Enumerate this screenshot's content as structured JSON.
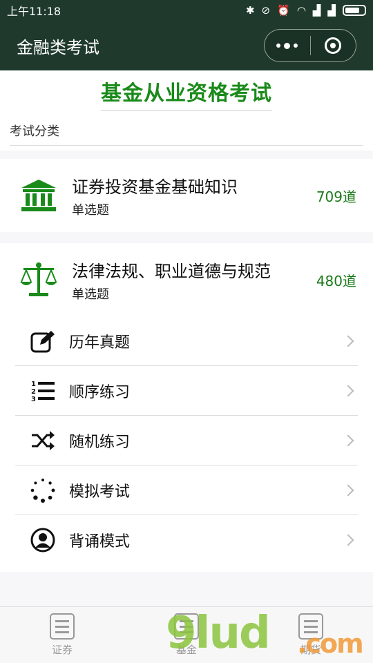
{
  "status_bar": {
    "time": "上午11:18"
  },
  "navbar": {
    "title": "金融类考试"
  },
  "page_title": "基金从业资格考试",
  "section_label": "考试分类",
  "subjects": [
    {
      "name": "证券投资基金基础知识",
      "type": "单选题",
      "count": "709道",
      "icon": "bank-building-icon"
    },
    {
      "name": "法律法规、职业道德与规范",
      "type": "单选题",
      "count": "480道",
      "icon": "scales-icon"
    }
  ],
  "menu": [
    {
      "label": "历年真题",
      "icon": "edit-icon"
    },
    {
      "label": "顺序练习",
      "icon": "numbered-list-icon"
    },
    {
      "label": "随机练习",
      "icon": "shuffle-icon"
    },
    {
      "label": "模拟考试",
      "icon": "loading-dots-icon"
    },
    {
      "label": "背诵模式",
      "icon": "user-circle-icon"
    }
  ],
  "tabs": [
    {
      "label": "证券"
    },
    {
      "label": "基金"
    },
    {
      "label": "期货"
    }
  ],
  "colors": {
    "nav_bg": "#1f3a2c",
    "accent_green": "#1a8a1a"
  },
  "watermark": {
    "main": "9lud",
    "suffix": ".com"
  }
}
